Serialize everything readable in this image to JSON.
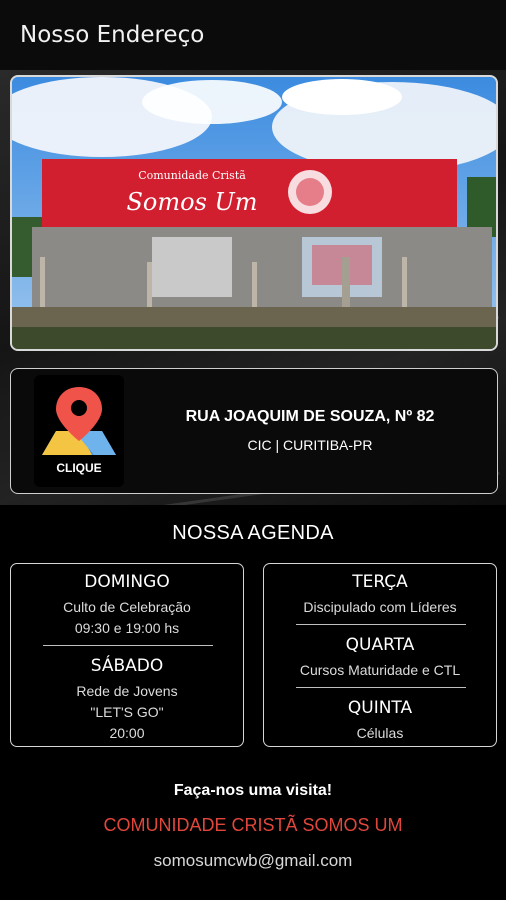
{
  "appbar": {
    "title": "Nosso Endereço"
  },
  "photo": {
    "sign_line1": "Comunidade Cristã",
    "sign_line2": "Somos Um"
  },
  "address": {
    "map_button_label": "CLIQUE",
    "street": "RUA JOAQUIM DE SOUZA, Nº 82",
    "city": "CIC | CURITIBA-PR"
  },
  "agenda": {
    "title": "NOSSA AGENDA",
    "left": [
      {
        "day": "DOMINGO",
        "lines": [
          "Culto de Celebração",
          "09:30 e 19:00 hs"
        ]
      },
      {
        "day": "SÁBADO",
        "lines": [
          "Rede de Jovens",
          "\"LET'S GO\"",
          "20:00"
        ]
      }
    ],
    "right": [
      {
        "day": "TERÇA",
        "lines": [
          "Discipulado com Líderes"
        ]
      },
      {
        "day": "QUARTA",
        "lines": [
          "Cursos Maturidade e CTL"
        ]
      },
      {
        "day": "QUINTA",
        "lines": [
          "Células"
        ]
      }
    ]
  },
  "footer": {
    "visit": "Faça-nos uma visita!",
    "church_name": "COMUNIDADE CRISTÃ SOMOS UM",
    "email": "somosumcwb@gmail.com"
  },
  "colors": {
    "accent_red": "#e0463c",
    "sign_red": "#d11f2f",
    "pin_red": "#f0534a",
    "background": "#000000"
  }
}
